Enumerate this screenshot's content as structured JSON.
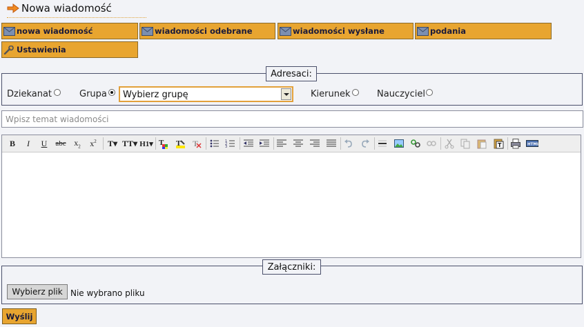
{
  "page": {
    "title": "Nowa wiadomość"
  },
  "nav": {
    "new_message": "nowa wiadomość",
    "received": "wiadomości odebrane",
    "sent": "wiadomości wysłane",
    "applications": "podania",
    "settings": "Ustawienia"
  },
  "recipients": {
    "legend": "Adresaci:",
    "dean_office": "Dziekanat",
    "group": "Grupa",
    "group_select_value": "Wybierz grupę",
    "field_of_study": "Kierunek",
    "teacher": "Nauczyciel",
    "selected": "group"
  },
  "subject": {
    "placeholder": "Wpisz temat wiadomości",
    "value": ""
  },
  "attachments": {
    "legend": "Załączniki:",
    "choose_file": "Wybierz plik",
    "no_file": "Nie wybrano pliku"
  },
  "send_button": "Wyślij",
  "toolbar": {
    "bold": "B",
    "italic": "I",
    "underline": "U",
    "strike": "abc",
    "subscript": "x",
    "superscript": "x",
    "font_size": "T",
    "font_family": "TT",
    "heading": "H1"
  },
  "colors": {
    "accent": "#e8a530",
    "border": "#4a4f6a",
    "background": "#f2f3f7"
  }
}
